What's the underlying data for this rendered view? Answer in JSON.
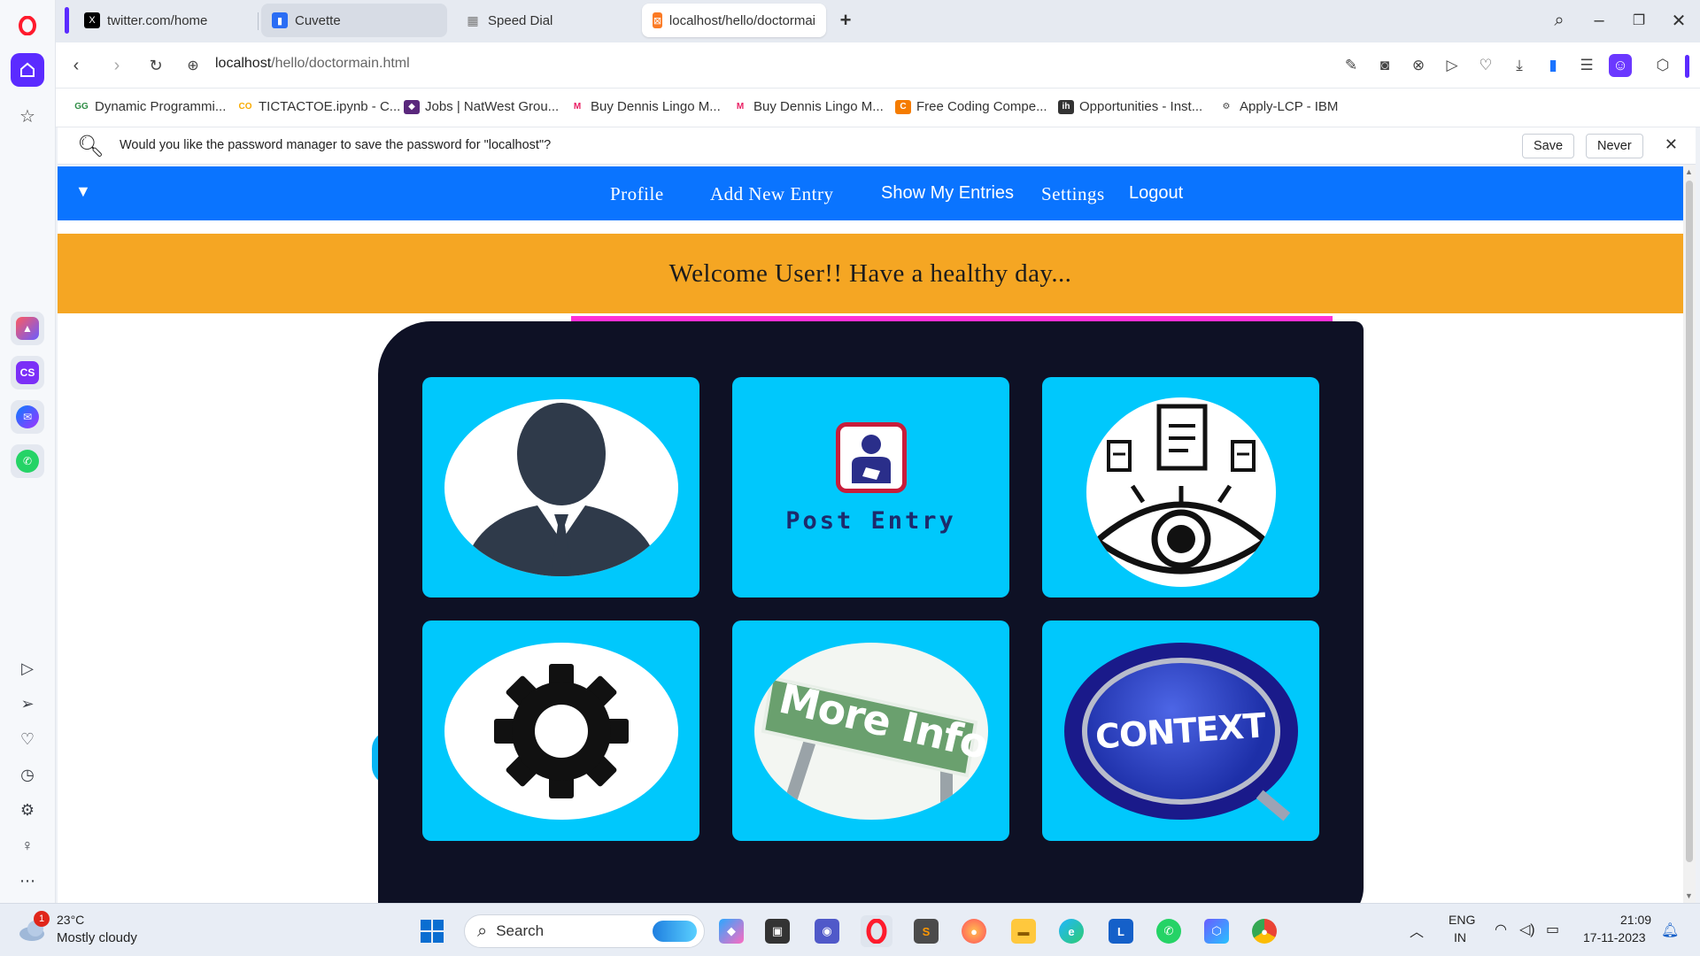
{
  "browser": {
    "tabs": [
      {
        "label": "twitter.com/home",
        "icon": "x-logo-icon",
        "color": "#000000"
      },
      {
        "label": "Cuvette",
        "icon": "cuvette-icon",
        "color": "#2a6df4"
      },
      {
        "label": "Speed Dial",
        "icon": "speed-dial-icon",
        "color": "#777777"
      },
      {
        "label": "localhost/hello/doctormai",
        "icon": "xampp-icon",
        "color": "#fb7a24"
      }
    ],
    "url": {
      "host": "localhost",
      "path": "/hello/doctormain.html"
    },
    "bookmarks": [
      {
        "label": "Dynamic Programmi...",
        "icon": "gfg-icon",
        "color": "#2f8d46"
      },
      {
        "label": "TICTACTOE.ipynb - C...",
        "icon": "colab-icon",
        "color": "#f9ab00"
      },
      {
        "label": "Jobs | NatWest Grou...",
        "icon": "natwest-icon",
        "color": "#5a287d"
      },
      {
        "label": "Buy Dennis Lingo M...",
        "icon": "myntra-icon",
        "color": "#e91e63"
      },
      {
        "label": "Buy Dennis Lingo M...",
        "icon": "myntra-icon",
        "color": "#e91e63"
      },
      {
        "label": "Free Coding Compe...",
        "icon": "coding-icon",
        "color": "#f57c00"
      },
      {
        "label": "Opportunities - Inst...",
        "icon": "internshala-icon",
        "color": "#333333"
      },
      {
        "label": "Apply-LCP - IBM",
        "icon": "ibm-icon",
        "color": "#444444"
      }
    ],
    "password_bar": {
      "message": "Would you like the password manager to save the password for \"localhost\"?",
      "save": "Save",
      "never": "Never"
    }
  },
  "page": {
    "nav": {
      "toggle": "▼",
      "links": [
        "Profile",
        "Add New Entry",
        "Show My Entries",
        "Settings",
        "Logout"
      ]
    },
    "welcome": "Welcome User!! Have a healthy day...",
    "cards": [
      {
        "name": "profile-card",
        "icon": "user-icon"
      },
      {
        "name": "post-entry-card",
        "icon": "post-entry-icon",
        "caption": "Post Entry"
      },
      {
        "name": "view-entries-card",
        "icon": "eye-documents-icon"
      },
      {
        "name": "settings-card",
        "icon": "gear-icon"
      },
      {
        "name": "more-info-card",
        "icon": "more-info-sign-icon",
        "caption": "More Info"
      },
      {
        "name": "context-card",
        "icon": "context-magnifier-icon",
        "caption": "CONTEXT"
      }
    ],
    "colors": {
      "nav": "#0a74ff",
      "welcome": "#f5a623",
      "panel": "#0e1125",
      "card": "#00c8fc",
      "accent": "#ff2fd6"
    }
  },
  "taskbar": {
    "weather": {
      "temp": "23°C",
      "condition": "Mostly cloudy",
      "badge": "1"
    },
    "search": "Search",
    "lang": {
      "top": "ENG",
      "bottom": "IN"
    },
    "time": "21:09",
    "date": "17-11-2023"
  }
}
